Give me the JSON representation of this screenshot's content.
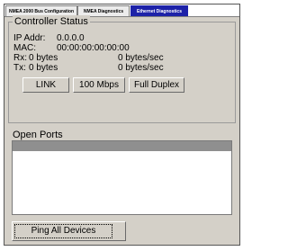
{
  "tabs": [
    {
      "label": "NMEA 2000 Bus Configuration",
      "active": false
    },
    {
      "label": "NMEA Diagnostics",
      "active": false
    },
    {
      "label": "Ethernet Diagnostics",
      "active": true
    }
  ],
  "controller_status": {
    "title": "Controller Status",
    "ip_label": "IP Addr:",
    "ip_value": "0.0.0.0",
    "mac_label": "MAC:",
    "mac_value": "00:00:00:00:00:00",
    "rx_label": "Rx:",
    "rx_value": "0 bytes",
    "rx_rate": "0 bytes/sec",
    "tx_label": "Tx:",
    "tx_value": "0 bytes",
    "tx_rate": "0 bytes/sec",
    "link_label": "LINK",
    "speed_label": "100 Mbps",
    "duplex_label": "Full Duplex"
  },
  "open_ports": {
    "title": "Open Ports"
  },
  "ping_button_label": "Ping All Devices",
  "colors": {
    "active_tab": "#1d22a8",
    "panel_bg": "#d4d0c8",
    "list_header": "#8f8f8f"
  }
}
